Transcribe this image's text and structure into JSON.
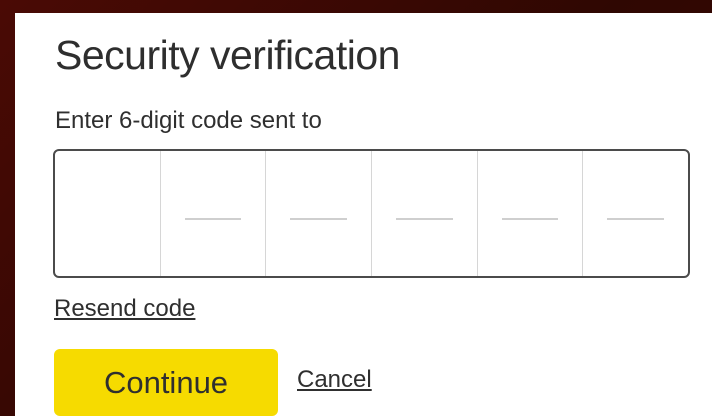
{
  "dialog": {
    "title": "Security verification",
    "instruction": "Enter 6-digit code sent to"
  },
  "otp": {
    "digits": [
      "",
      "",
      "",
      "",
      "",
      ""
    ]
  },
  "actions": {
    "resend_label": "Resend code",
    "continue_label": "Continue",
    "cancel_label": "Cancel"
  },
  "colors": {
    "background": "#3b0803",
    "card": "#ffffff",
    "primary_button": "#f6db00",
    "text": "#2f2f2f",
    "input_border": "#4b4b4b"
  }
}
